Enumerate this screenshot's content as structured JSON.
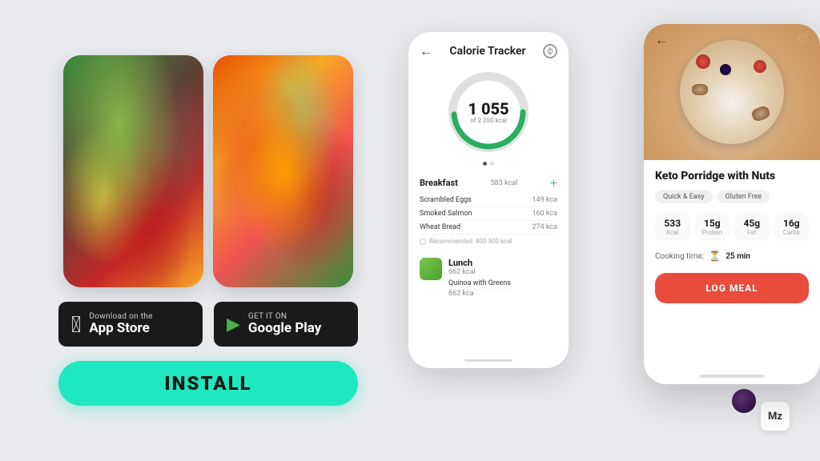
{
  "background": "#e8eaed",
  "left": {
    "food_images": [
      {
        "alt": "Salad with grapefruit and pecans"
      },
      {
        "alt": "Shrimp and citrus salad"
      }
    ],
    "app_store": {
      "subtitle": "Download on the",
      "title": "App Store",
      "icon": ""
    },
    "google_play": {
      "subtitle": "GET IT ON",
      "title": "Google Play",
      "icon": "▶"
    },
    "install_label": "INSTALL"
  },
  "phone1": {
    "title": "Calorie Tracker",
    "back_label": "←",
    "calories": {
      "value": "1 055",
      "of_label": "of 2 200 kcal"
    },
    "breakfast": {
      "title": "Breakfast",
      "kcal": "583 kcal",
      "items": [
        {
          "name": "Scrambled Eggs",
          "kcal": "149 kca"
        },
        {
          "name": "Smoked Salmon",
          "kcal": "160 kca"
        },
        {
          "name": "Wheat Bread",
          "kcal": "274 kca"
        }
      ],
      "recommended": "Recommended: 400-500 kcal"
    },
    "lunch": {
      "title": "Lunch",
      "kcal": "662 kcal",
      "items": [
        {
          "name": "Quinoa with Greens",
          "kcal": "662 kca"
        }
      ]
    }
  },
  "phone2": {
    "recipe_title": "Keto Porridge with Nuts",
    "back_label": "←",
    "tags": [
      "Quick & Easy",
      "Gluten Free"
    ],
    "nutrition": [
      {
        "value": "533",
        "label": "Kcal"
      },
      {
        "value": "15g",
        "label": "Protein"
      },
      {
        "value": "45g",
        "label": "Fat"
      },
      {
        "value": "16g",
        "label": "Carbs"
      }
    ],
    "cooking_time_label": "Cooking time:",
    "cooking_time_value": "25 min",
    "log_meal_label": "LOG MEAL"
  },
  "mz_badge": "Mz"
}
